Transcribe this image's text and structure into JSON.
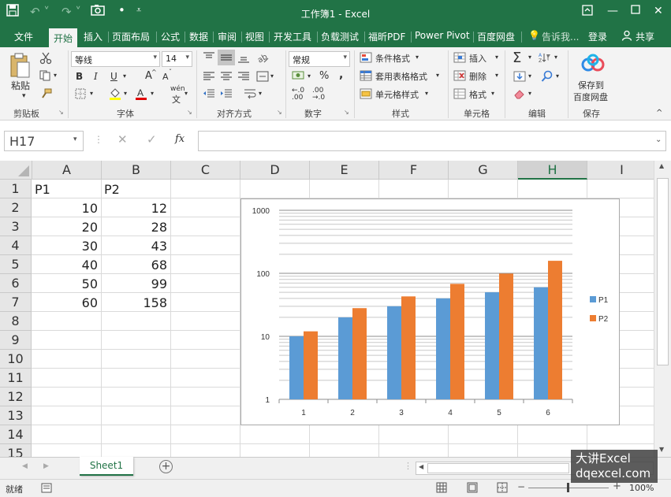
{
  "app": {
    "title": "工作簿1 - Excel"
  },
  "ribbon_tabs": [
    "文件",
    "开始",
    "插入",
    "页面布局",
    "公式",
    "数据",
    "审阅",
    "视图",
    "开发工具",
    "负载测试",
    "福昕PDF",
    "Power Pivot",
    "百度网盘"
  ],
  "active_tab": "开始",
  "tell_me": "告诉我...",
  "login": "登录",
  "share": "共享",
  "ribbon": {
    "paste": "粘贴",
    "clipboard_label": "剪贴板",
    "font_name": "等线",
    "font_size": "14",
    "font_label": "字体",
    "bold": "B",
    "italic": "I",
    "underline": "U",
    "font_grow": "A",
    "font_shrink": "A",
    "wen": "wén",
    "align_label": "对齐方式",
    "number_format": "常规",
    "number_label": "数字",
    "conditional_format": "条件格式",
    "table_format": "套用表格格式",
    "cell_style": "单元格样式",
    "style_label": "样式",
    "insert": "插入",
    "delete": "删除",
    "format": "格式",
    "cells_label": "单元格",
    "edit_label": "编辑",
    "save_to_baidu": "保存到",
    "save_to_baidu2": "百度网盘",
    "save_label": "保存"
  },
  "formula": {
    "name_box": "H17",
    "fx": "fx",
    "value": ""
  },
  "columns": [
    "A",
    "B",
    "C",
    "D",
    "E",
    "F",
    "G",
    "H",
    "I"
  ],
  "selected_column": "H",
  "rows": [
    "1",
    "2",
    "3",
    "4",
    "5",
    "6",
    "7",
    "8",
    "9",
    "10",
    "11",
    "12",
    "13",
    "14",
    "15"
  ],
  "cells": {
    "A1": "P1",
    "B1": "P2",
    "A2": "10",
    "B2": "12",
    "A3": "20",
    "B3": "28",
    "A4": "30",
    "B4": "43",
    "A5": "40",
    "B5": "68",
    "A6": "50",
    "B6": "99",
    "A7": "60",
    "B7": "158"
  },
  "sheet_tab": "Sheet1",
  "status": {
    "ready": "就绪",
    "zoom": "100%"
  },
  "watermark": {
    "line1": "大讲Excel",
    "line2": "dqexcel.com"
  },
  "colors": {
    "excel_green": "#217346",
    "series_p1": "#5b9bd5",
    "series_p2": "#ed7d31"
  },
  "chart_data": {
    "type": "bar",
    "title": "",
    "categories": [
      "1",
      "2",
      "3",
      "4",
      "5",
      "6"
    ],
    "series": [
      {
        "name": "P1",
        "values": [
          10,
          20,
          30,
          40,
          50,
          60
        ],
        "color": "#5b9bd5"
      },
      {
        "name": "P2",
        "values": [
          12,
          28,
          43,
          68,
          99,
          158
        ],
        "color": "#ed7d31"
      }
    ],
    "y_scale": "log",
    "ylim": [
      1,
      1000
    ],
    "y_ticks": [
      "1",
      "10",
      "100",
      "1000"
    ],
    "legend": "right",
    "grid": true
  }
}
